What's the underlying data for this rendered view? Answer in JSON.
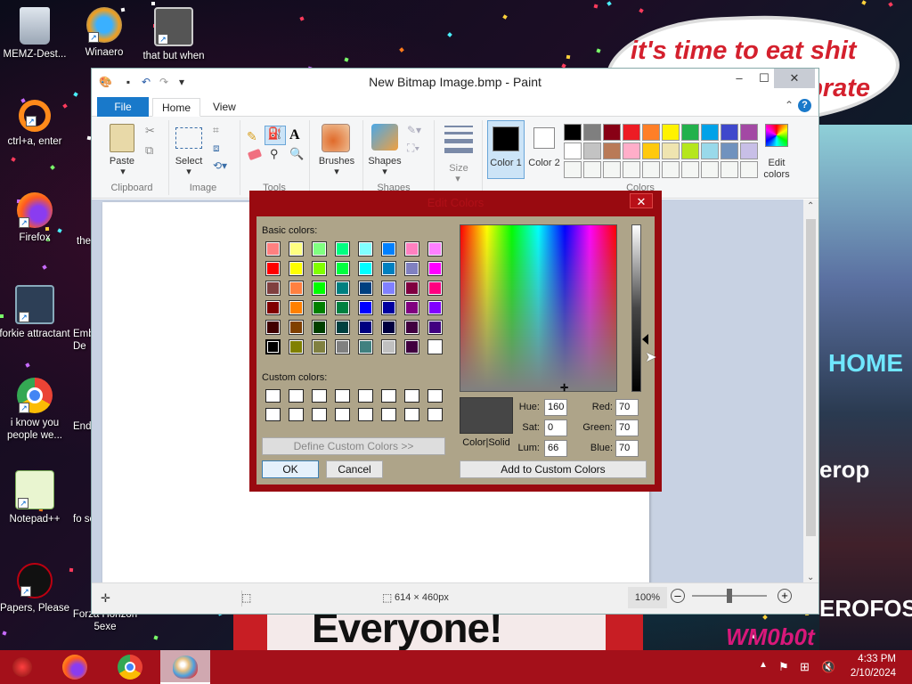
{
  "wallpaper": {
    "speech_line1": "it's time to eat shit",
    "speech_line2": "ebrate",
    "banner": "Everyone!",
    "home": "HOME",
    "erop": "erop",
    "erofo": "EROFOS",
    "wm": "WM0b0t"
  },
  "desktop_icons": [
    {
      "label": "MEMZ-Dest..."
    },
    {
      "label": "Winaero"
    },
    {
      "label": "that but when"
    },
    {
      "label": "ctrl+a, enter"
    },
    {
      "label": "Firefox"
    },
    {
      "label": "the"
    },
    {
      "label": "forkie attractant"
    },
    {
      "label": "Emb De"
    },
    {
      "label": "i know you people we..."
    },
    {
      "label": "End"
    },
    {
      "label": "Notepad++"
    },
    {
      "label": "fo son"
    },
    {
      "label": "Papers, Please"
    },
    {
      "label": "Forza Horizon 5exe"
    }
  ],
  "paint": {
    "title": "New Bitmap Image.bmp - Paint",
    "tabs": {
      "file": "File",
      "home": "Home",
      "view": "View"
    },
    "ribbon": {
      "paste": "Paste",
      "select": "Select",
      "brushes": "Brushes",
      "shapes": "Shapes",
      "size": "Size",
      "color1": "Color 1",
      "color2": "Color 2",
      "edit_colors": "Edit colors",
      "groups": {
        "clipboard": "Clipboard",
        "image": "Image",
        "tools": "Tools",
        "shapes": "Shapes",
        "colors": "Colors"
      }
    },
    "palette_row1": [
      "#000000",
      "#7f7f7f",
      "#880015",
      "#ed1c24",
      "#ff7f27",
      "#fff200",
      "#22b14c",
      "#00a2e8",
      "#3f48cc",
      "#a349a4"
    ],
    "palette_row2": [
      "#ffffff",
      "#c3c3c3",
      "#b97a57",
      "#ffaec9",
      "#ffc90e",
      "#efe4b0",
      "#b5e61d",
      "#99d9ea",
      "#7092be",
      "#c8bfe7"
    ],
    "status": {
      "dimensions": "614 × 460px",
      "zoom": "100%"
    }
  },
  "dialog": {
    "title": "Edit Colors",
    "basic_colors_label": "Basic colors:",
    "custom_colors_label": "Custom colors:",
    "define_button": "Define Custom Colors >>",
    "ok_button": "OK",
    "cancel_button": "Cancel",
    "add_button": "Add to Custom Colors",
    "colorsolid_label": "Color|Solid",
    "fields": {
      "hue_label": "Hue:",
      "hue": "160",
      "sat_label": "Sat:",
      "sat": "0",
      "lum_label": "Lum:",
      "lum": "66",
      "red_label": "Red:",
      "red": "70",
      "green_label": "Green:",
      "green": "70",
      "blue_label": "Blue:",
      "blue": "70"
    },
    "basic_colors": [
      [
        "#ff8080",
        "#ffff80",
        "#80ff80",
        "#00ff80",
        "#80ffff",
        "#0080ff",
        "#ff80c0",
        "#ff80ff"
      ],
      [
        "#ff0000",
        "#ffff00",
        "#80ff00",
        "#00ff40",
        "#00ffff",
        "#0080c0",
        "#8080c0",
        "#ff00ff"
      ],
      [
        "#804040",
        "#ff8040",
        "#00ff00",
        "#008080",
        "#004080",
        "#8080ff",
        "#800040",
        "#ff0080"
      ],
      [
        "#800000",
        "#ff8000",
        "#008000",
        "#008040",
        "#0000ff",
        "#0000a0",
        "#800080",
        "#8000ff"
      ],
      [
        "#400000",
        "#804000",
        "#004000",
        "#004040",
        "#000080",
        "#000040",
        "#400040",
        "#400080"
      ],
      [
        "#000000",
        "#808000",
        "#808040",
        "#808080",
        "#408080",
        "#c0c0c0",
        "#400040",
        "#ffffff"
      ]
    ]
  },
  "taskbar": {
    "time": "4:33 PM",
    "date": "2/10/2024"
  }
}
